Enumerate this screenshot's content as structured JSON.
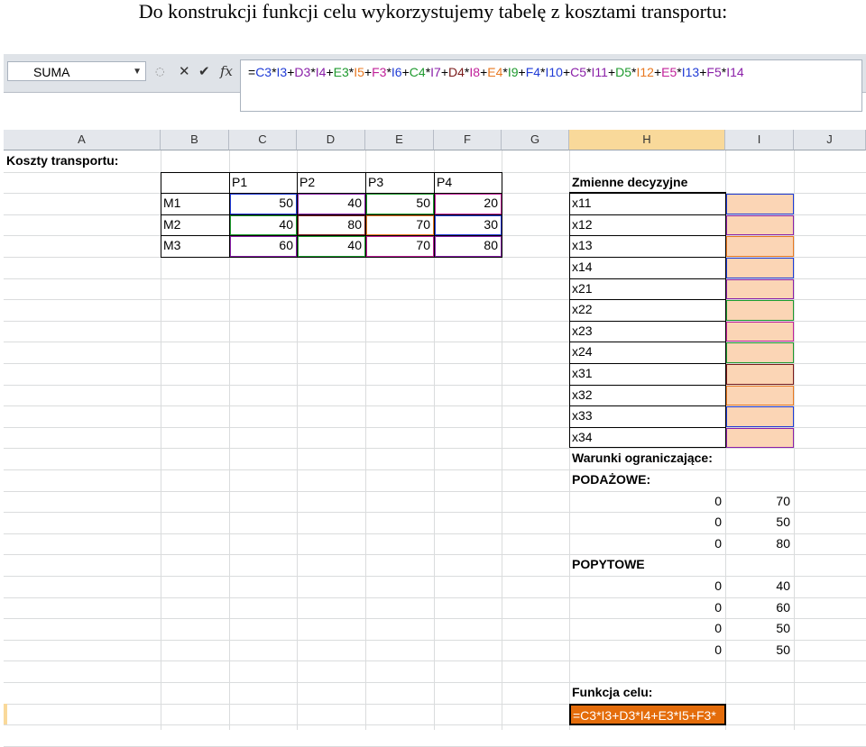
{
  "caption": "Do konstrukcji funkcji celu wykorzystujemy tabelę z kosztami transportu:",
  "formula_bar": {
    "name_box": "SUMA",
    "cancel_symbol": "✕",
    "confirm_symbol": "✔",
    "fx_symbol": "fx",
    "formula_parts": [
      {
        "text": "=",
        "color": "#000000"
      },
      {
        "text": "C3",
        "color": "#1f3bd6"
      },
      {
        "text": "*",
        "color": "#000000"
      },
      {
        "text": "I3",
        "color": "#1f3bd6"
      },
      {
        "text": "+",
        "color": "#000000"
      },
      {
        "text": "D3",
        "color": "#8a1fa8"
      },
      {
        "text": "*",
        "color": "#000000"
      },
      {
        "text": "I4",
        "color": "#8a1fa8"
      },
      {
        "text": "+",
        "color": "#000000"
      },
      {
        "text": "E3",
        "color": "#1e9a2e"
      },
      {
        "text": "*",
        "color": "#000000"
      },
      {
        "text": "I5",
        "color": "#e87820"
      },
      {
        "text": "+",
        "color": "#000000"
      },
      {
        "text": "F3",
        "color": "#c0209a"
      },
      {
        "text": "*",
        "color": "#000000"
      },
      {
        "text": "I6",
        "color": "#1f3bd6"
      },
      {
        "text": "+",
        "color": "#000000"
      },
      {
        "text": "C4",
        "color": "#1e9a2e"
      },
      {
        "text": "*",
        "color": "#000000"
      },
      {
        "text": "I7",
        "color": "#8a1fa8"
      },
      {
        "text": "+",
        "color": "#000000"
      },
      {
        "text": "D4",
        "color": "#7a1a1a"
      },
      {
        "text": "*",
        "color": "#000000"
      },
      {
        "text": "I8",
        "color": "#c0209a"
      },
      {
        "text": "+",
        "color": "#000000"
      },
      {
        "text": "E4",
        "color": "#e87820"
      },
      {
        "text": "*",
        "color": "#000000"
      },
      {
        "text": "I9",
        "color": "#1e9a2e"
      },
      {
        "text": "+",
        "color": "#000000"
      },
      {
        "text": "F4",
        "color": "#1f3bd6"
      },
      {
        "text": "*",
        "color": "#000000"
      },
      {
        "text": "I10",
        "color": "#1f3bd6"
      },
      {
        "text": "+",
        "color": "#000000"
      },
      {
        "text": "C5",
        "color": "#8a1fa8"
      },
      {
        "text": "*",
        "color": "#000000"
      },
      {
        "text": "I11",
        "color": "#8a1fa8"
      },
      {
        "text": "+",
        "color": "#000000"
      },
      {
        "text": "D5",
        "color": "#1e9a2e"
      },
      {
        "text": "*",
        "color": "#000000"
      },
      {
        "text": "I12",
        "color": "#e87820"
      },
      {
        "text": "+",
        "color": "#000000"
      },
      {
        "text": "E5",
        "color": "#c0209a"
      },
      {
        "text": "*",
        "color": "#000000"
      },
      {
        "text": "I13",
        "color": "#1f3bd6"
      },
      {
        "text": "+",
        "color": "#000000"
      },
      {
        "text": "F5",
        "color": "#8a1fa8"
      },
      {
        "text": "*",
        "color": "#000000"
      },
      {
        "text": "I14",
        "color": "#8a1fa8"
      }
    ]
  },
  "columns": [
    "A",
    "B",
    "C",
    "D",
    "E",
    "F",
    "G",
    "H",
    "I",
    "J"
  ],
  "sheet": {
    "title": "Koszty transportu:",
    "cost_headers": [
      "P1",
      "P2",
      "P3",
      "P4"
    ],
    "cost_rows": [
      {
        "label": "M1",
        "values": [
          "50",
          "40",
          "50",
          "20"
        ]
      },
      {
        "label": "M2",
        "values": [
          "40",
          "80",
          "70",
          "30"
        ]
      },
      {
        "label": "M3",
        "values": [
          "60",
          "40",
          "70",
          "80"
        ]
      }
    ],
    "decision_header": "Zmienne decyzyjne",
    "decision_vars": [
      "x11",
      "x12",
      "x13",
      "x14",
      "x21",
      "x22",
      "x23",
      "x24",
      "x31",
      "x32",
      "x33",
      "x34"
    ],
    "constraints_title": "Warunki ograniczające:",
    "supply_title": "PODAŻOWE:",
    "supply_rows": [
      [
        "0",
        "70"
      ],
      [
        "0",
        "50"
      ],
      [
        "0",
        "80"
      ]
    ],
    "demand_title": "POPYTOWE",
    "demand_rows": [
      [
        "0",
        "40"
      ],
      [
        "0",
        "60"
      ],
      [
        "0",
        "50"
      ],
      [
        "0",
        "50"
      ]
    ],
    "objective_title": "Funkcja celu:",
    "objective_cell": "=C3*I3+D3*I4+E3*I5+F3*"
  },
  "colors": {
    "header_selected": "#f9d99a",
    "shade": "#fbd5b5",
    "active_cell": "#e46c0a"
  }
}
